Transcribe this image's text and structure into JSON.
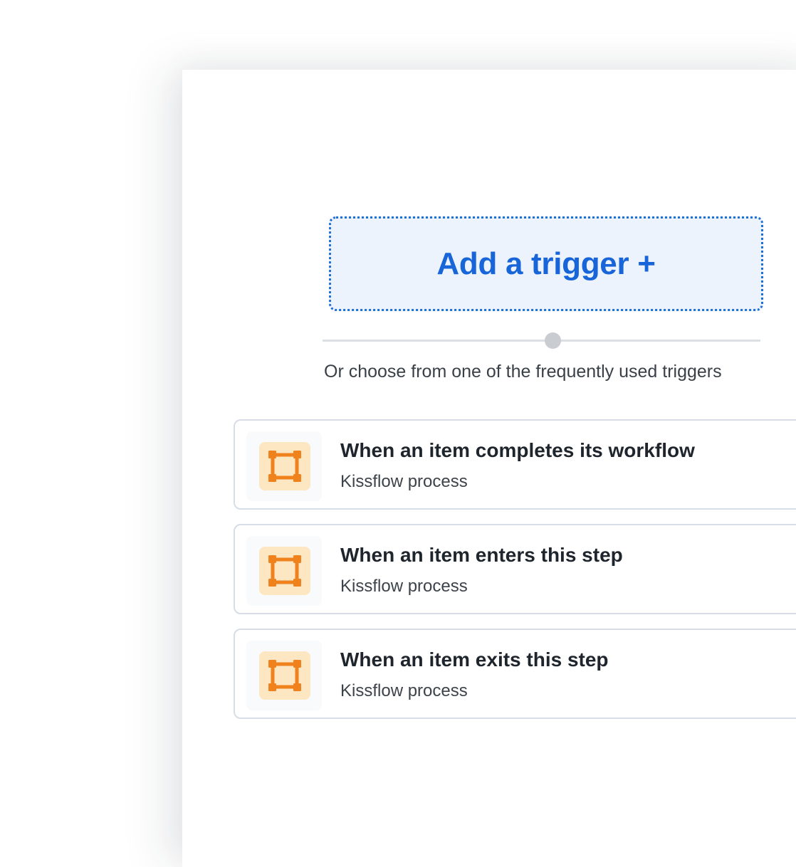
{
  "trigger": {
    "label": "Add a trigger +"
  },
  "hint": "Or choose from one of the frequently used triggers",
  "triggers": [
    {
      "title": "When an item completes its workflow",
      "subtitle": "Kissflow process",
      "icon": "process-icon"
    },
    {
      "title": "When an item enters this step",
      "subtitle": "Kissflow process",
      "icon": "process-icon"
    },
    {
      "title": "When an item exits this step",
      "subtitle": "Kissflow process",
      "icon": "process-icon"
    }
  ],
  "colors": {
    "accent": "#1765d8",
    "trigger_bg": "#ecf3fd",
    "icon_orange": "#f0821e",
    "icon_bg": "#fde7c3"
  }
}
